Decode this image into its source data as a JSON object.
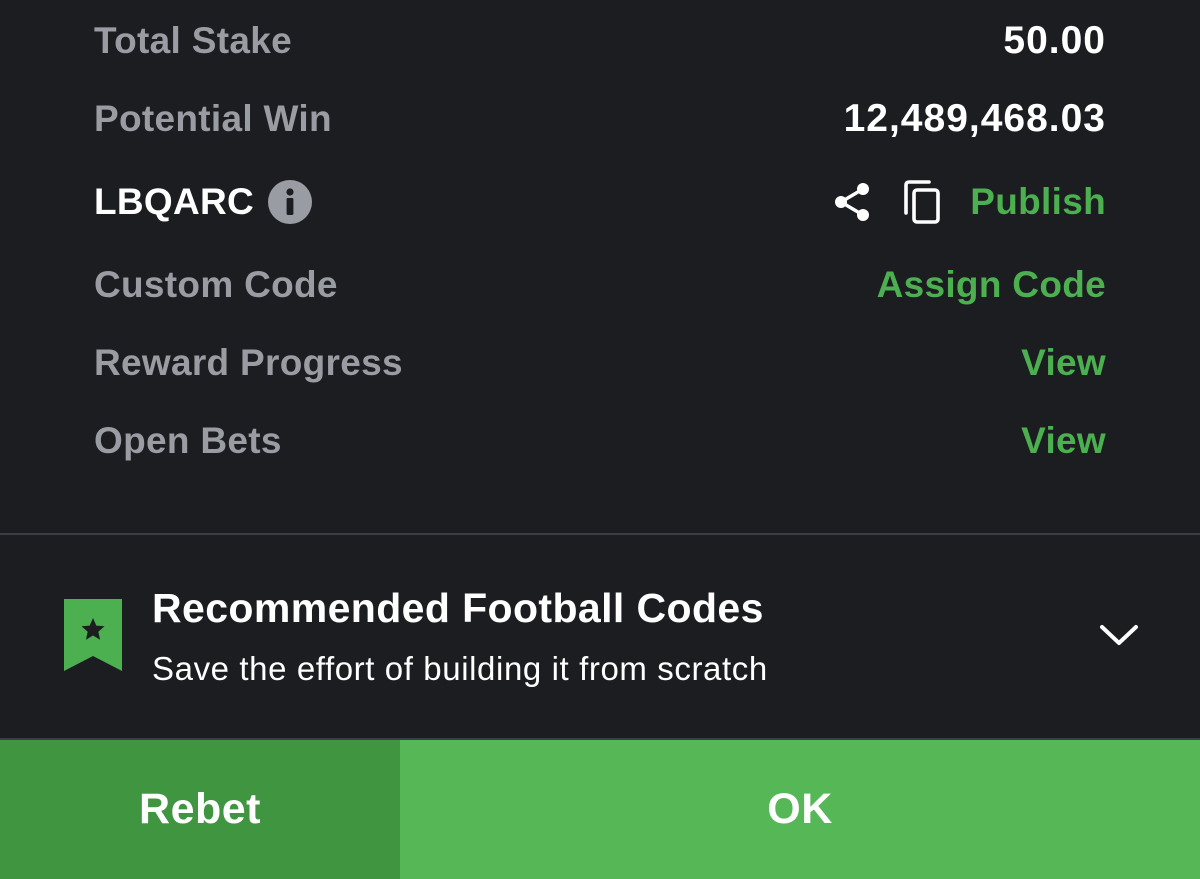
{
  "summary": {
    "total_stake": {
      "label": "Total Stake",
      "value": "50.00"
    },
    "potential_win": {
      "label": "Potential Win",
      "value": "12,489,468.03"
    },
    "booking_code": {
      "code": "LBQARC",
      "info_icon": "info-icon",
      "share_icon": "share-icon",
      "copy_icon": "copy-icon",
      "publish_label": "Publish"
    },
    "custom_code": {
      "label": "Custom Code",
      "action": "Assign Code"
    },
    "reward_progress": {
      "label": "Reward Progress",
      "action": "View"
    },
    "open_bets": {
      "label": "Open Bets",
      "action": "View"
    }
  },
  "recommended": {
    "icon": "bookmark-star-icon",
    "title": "Recommended Football Codes",
    "subtitle": "Save the effort of building it from scratch",
    "toggle_icon": "chevron-down-icon"
  },
  "actions": {
    "rebet_label": "Rebet",
    "ok_label": "OK"
  },
  "colors": {
    "background": "#1b1d21",
    "accent_green": "#4caf50",
    "rebet_bg": "#3f9540",
    "ok_bg": "#55b756",
    "muted_text": "#9a9ca3"
  }
}
